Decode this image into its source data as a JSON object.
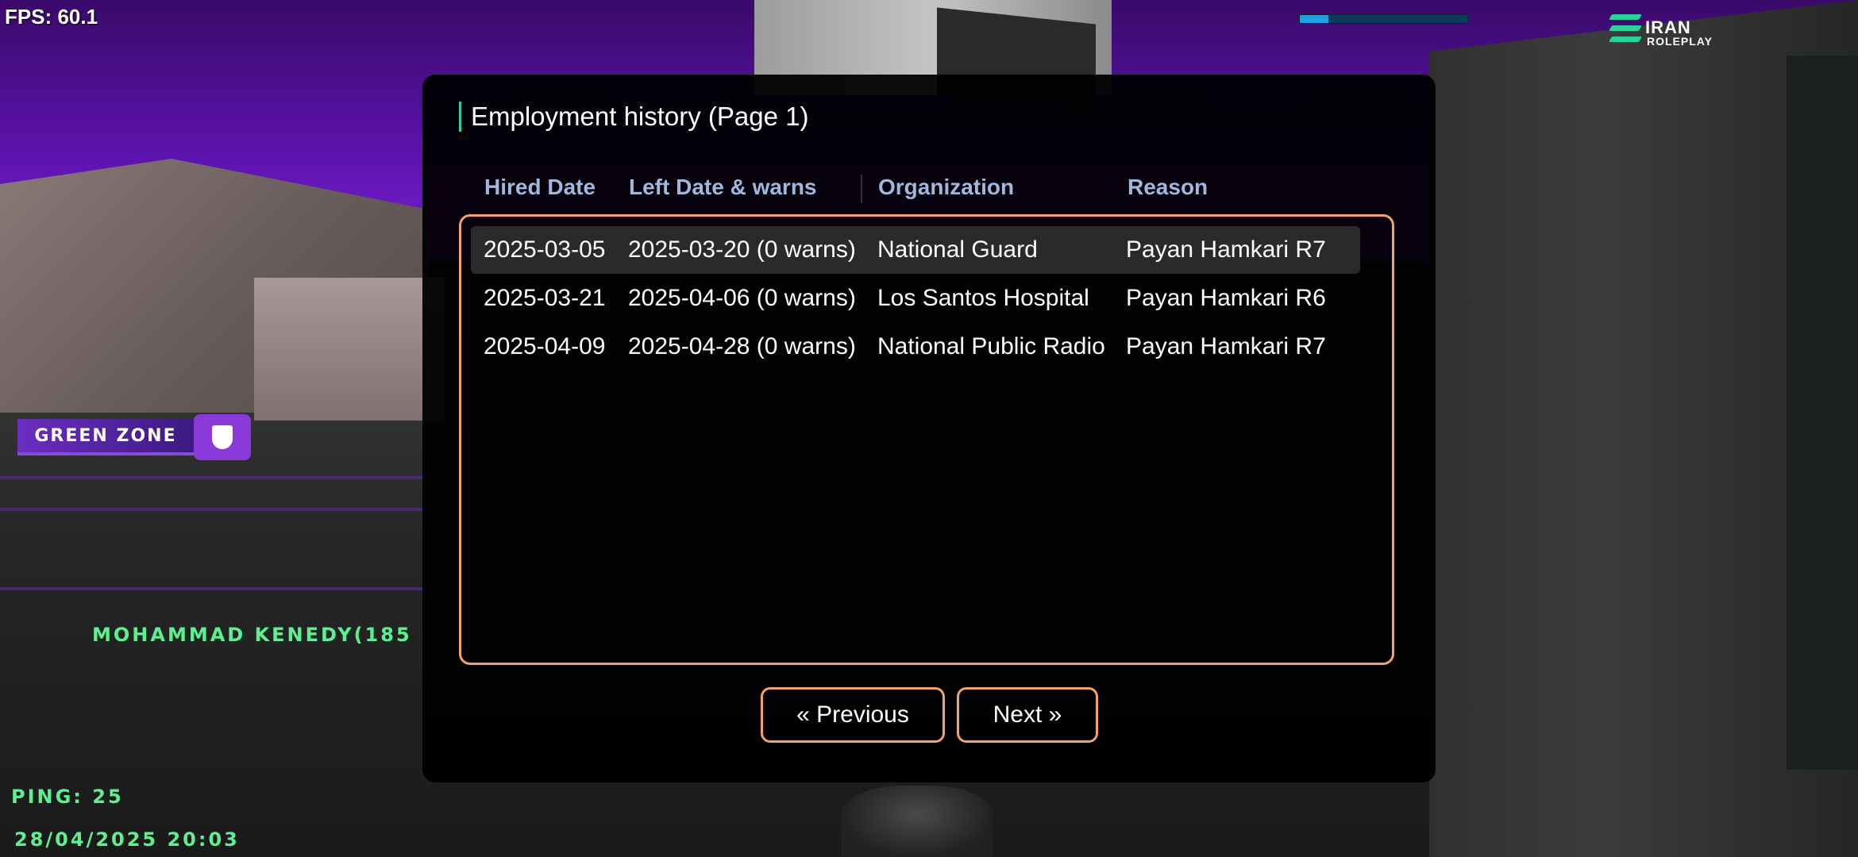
{
  "hud": {
    "fps": "FPS: 60.1",
    "ping": "PING: 25",
    "datetime": "28/04/2025 20:03",
    "player_name": "MOHAMMAD KENEDY(185",
    "zone": "GREEN ZONE",
    "logo_line1": "IRAN",
    "logo_line2": "ROLEPLAY",
    "top_bar_progress": 0.17,
    "accent_color": "#f0a36a",
    "hud_text_color": "#5ef090"
  },
  "dialog": {
    "title": "Employment history (Page 1)",
    "columns": [
      "Hired Date",
      "Left Date & warns",
      "Organization",
      "Reason"
    ],
    "rows": [
      {
        "hired": "2025-03-05",
        "left": "2025-03-20 (0 warns)",
        "org": "National Guard",
        "reason": "Payan Hamkari R7",
        "selected": true
      },
      {
        "hired": "2025-03-21",
        "left": "2025-04-06 (0 warns)",
        "org": "Los Santos Hospital",
        "reason": "Payan Hamkari R6",
        "selected": false
      },
      {
        "hired": "2025-04-09",
        "left": "2025-04-28 (0 warns)",
        "org": "National Public Radio",
        "reason": "Payan Hamkari R7",
        "selected": false
      }
    ],
    "prev_label": "« Previous",
    "next_label": "Next »"
  }
}
